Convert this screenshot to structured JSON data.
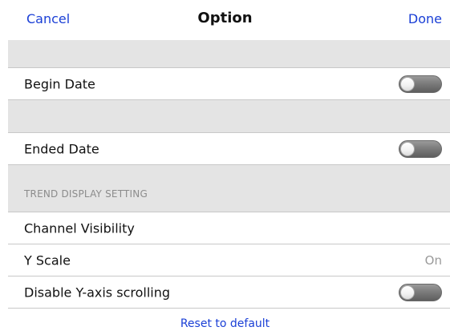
{
  "nav": {
    "cancel_label": "Cancel",
    "title": "Option",
    "done_label": "Done"
  },
  "rows": {
    "begin_date": {
      "label": "Begin Date",
      "toggle_on": false
    },
    "ended_date": {
      "label": "Ended Date",
      "toggle_on": false
    },
    "channel_visibility": {
      "label": "Channel Visibility"
    },
    "y_scale": {
      "label": "Y Scale",
      "value": "On"
    },
    "disable_y_scroll": {
      "label": "Disable Y-axis scrolling",
      "toggle_on": false
    }
  },
  "sections": {
    "trend_header": "TREND DISPLAY SETTING"
  },
  "footer": {
    "reset_label": "Reset to default"
  },
  "colors": {
    "link": "#1a3fd6",
    "section_bg": "#e4e4e4",
    "secondary_text": "#9a9a9a"
  }
}
